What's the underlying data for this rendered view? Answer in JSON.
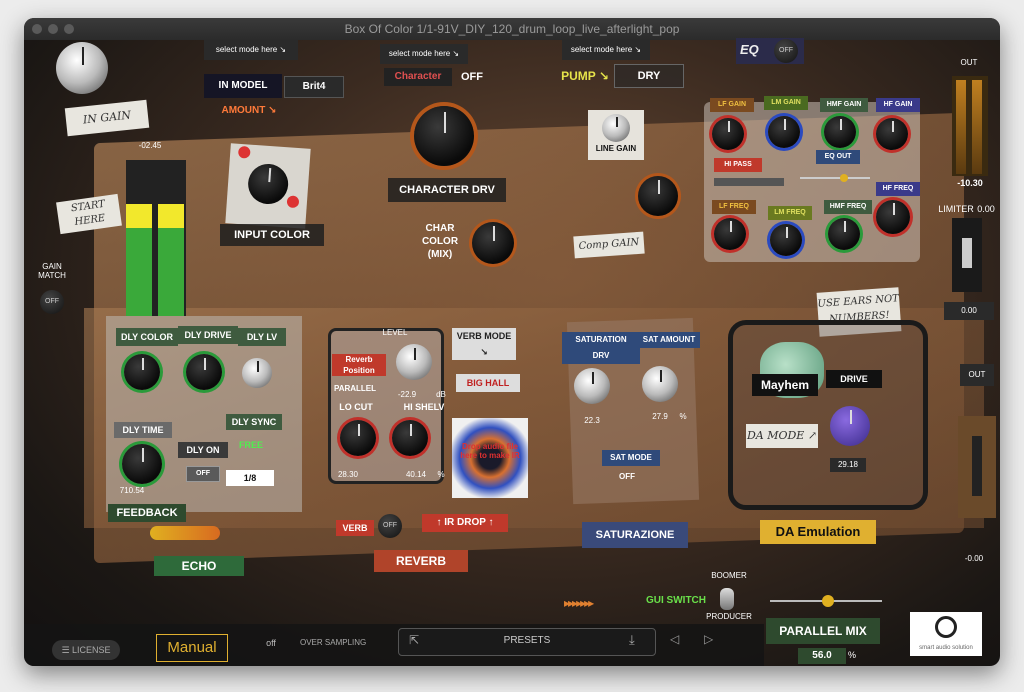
{
  "window": {
    "title": "Box Of Color 1/1-91V_DIY_120_drum_loop_live_afterlight_pop"
  },
  "input": {
    "gain_label": "IN GAIN",
    "gain_value": "-02.45",
    "start_here": "START HERE",
    "gain_match_label": "GAIN MATCH",
    "gain_match_toggle": "OFF",
    "input_color_label": "INPUT COLOR"
  },
  "model": {
    "select_hint": "select mode here ↘",
    "label": "IN MODEL",
    "value": "Brit4",
    "amount_label": "AMOUNT ↘"
  },
  "character": {
    "select_hint": "select mode here ↘",
    "label": "Character",
    "value": "OFF",
    "drive_label": "CHARACTER DRV",
    "color_mix_label": "CHAR\nCOLOR\n(MIX)"
  },
  "pump": {
    "select_hint": "select mode here ↘",
    "label": "PUMP ↘",
    "value": "DRY",
    "line_gain_label": "LINE GAIN",
    "comp_gain_label": "Comp GAIN"
  },
  "eq": {
    "title": "EQ",
    "toggle": "OFF",
    "lf_gain": "LF GAIN",
    "lm_gain": "LM GAIN",
    "hmf_gain": "HMF GAIN",
    "hf_gain": "HF GAIN",
    "hi_pass": "HI PASS",
    "eq_out": "EQ OUT",
    "lf_freq": "LF FREQ",
    "lm_freq": "LM FREQ",
    "hmf_freq": "HMF FREQ",
    "hf_freq": "HF FREQ"
  },
  "output": {
    "out_label": "OUT",
    "out_value": "-10.30",
    "limiter_label": "LIMITER",
    "limiter_value": "0.00",
    "limiter_readout": "0.00",
    "out2_label": "OUT",
    "out2_value": "-0.00"
  },
  "echo": {
    "dly_color": "DLY COLOR",
    "dly_drive": "DLY DRIVE",
    "dly_lv": "DLY LV",
    "dly_time": "DLY TIME",
    "dly_time_value": "710.54",
    "dly_on": "DLY ON",
    "dly_on_toggle": "OFF",
    "dly_sync": "DLY SYNC",
    "sync_free": "FREE",
    "sync_value": "1/8",
    "feedback": "FEEDBACK",
    "section": "ECHO"
  },
  "reverb": {
    "level_label": "LEVEL",
    "level_value": "-22.9",
    "level_unit": "dB",
    "position_label": "Reverb\nPosition",
    "position_value": "PARALLEL",
    "lo_cut": "LO CUT",
    "hi_shelv": "HI SHELV",
    "lo_cut_value": "28.30",
    "hi_shelv_value": "40.14",
    "hi_shelv_unit": "%",
    "verb_mode": "VERB MODE ↘",
    "verb_mode_value": "BIG HALL",
    "ir_drop_hint": "Drop audio file here to make IR",
    "verb_label": "VERB",
    "verb_toggle": "OFF",
    "ir_drop": "↑ IR DROP ↑",
    "section": "REVERB"
  },
  "saturation": {
    "sat_drv": "SATURATION DRV",
    "sat_amount": "SAT AMOUNT",
    "drv_value": "22.3",
    "amount_value": "27.9",
    "amount_unit": "%",
    "mode_label": "SAT MODE",
    "mode_value": "OFF",
    "section": "SATURAZIONE"
  },
  "da": {
    "use_ears": "USE EARS NOT NUMBERS!",
    "mayhem": "Mayhem",
    "drive": "DRIVE",
    "da_mode": "DA MODE ↗",
    "value": "29.18",
    "section": "DA Emulation"
  },
  "bottom": {
    "gui_switch": "GUI SWITCH",
    "boomer": "BOOMER",
    "producer": "PRODUCER",
    "parallel_mix": "PARALLEL MIX",
    "mix_value": "56.0",
    "mix_unit": "%",
    "license": "LICENSE",
    "manual": "Manual",
    "oversampling_value": "off",
    "oversampling_label": "OVER SAMPLING",
    "presets": "PRESETS",
    "brand": "smart audio solution"
  }
}
